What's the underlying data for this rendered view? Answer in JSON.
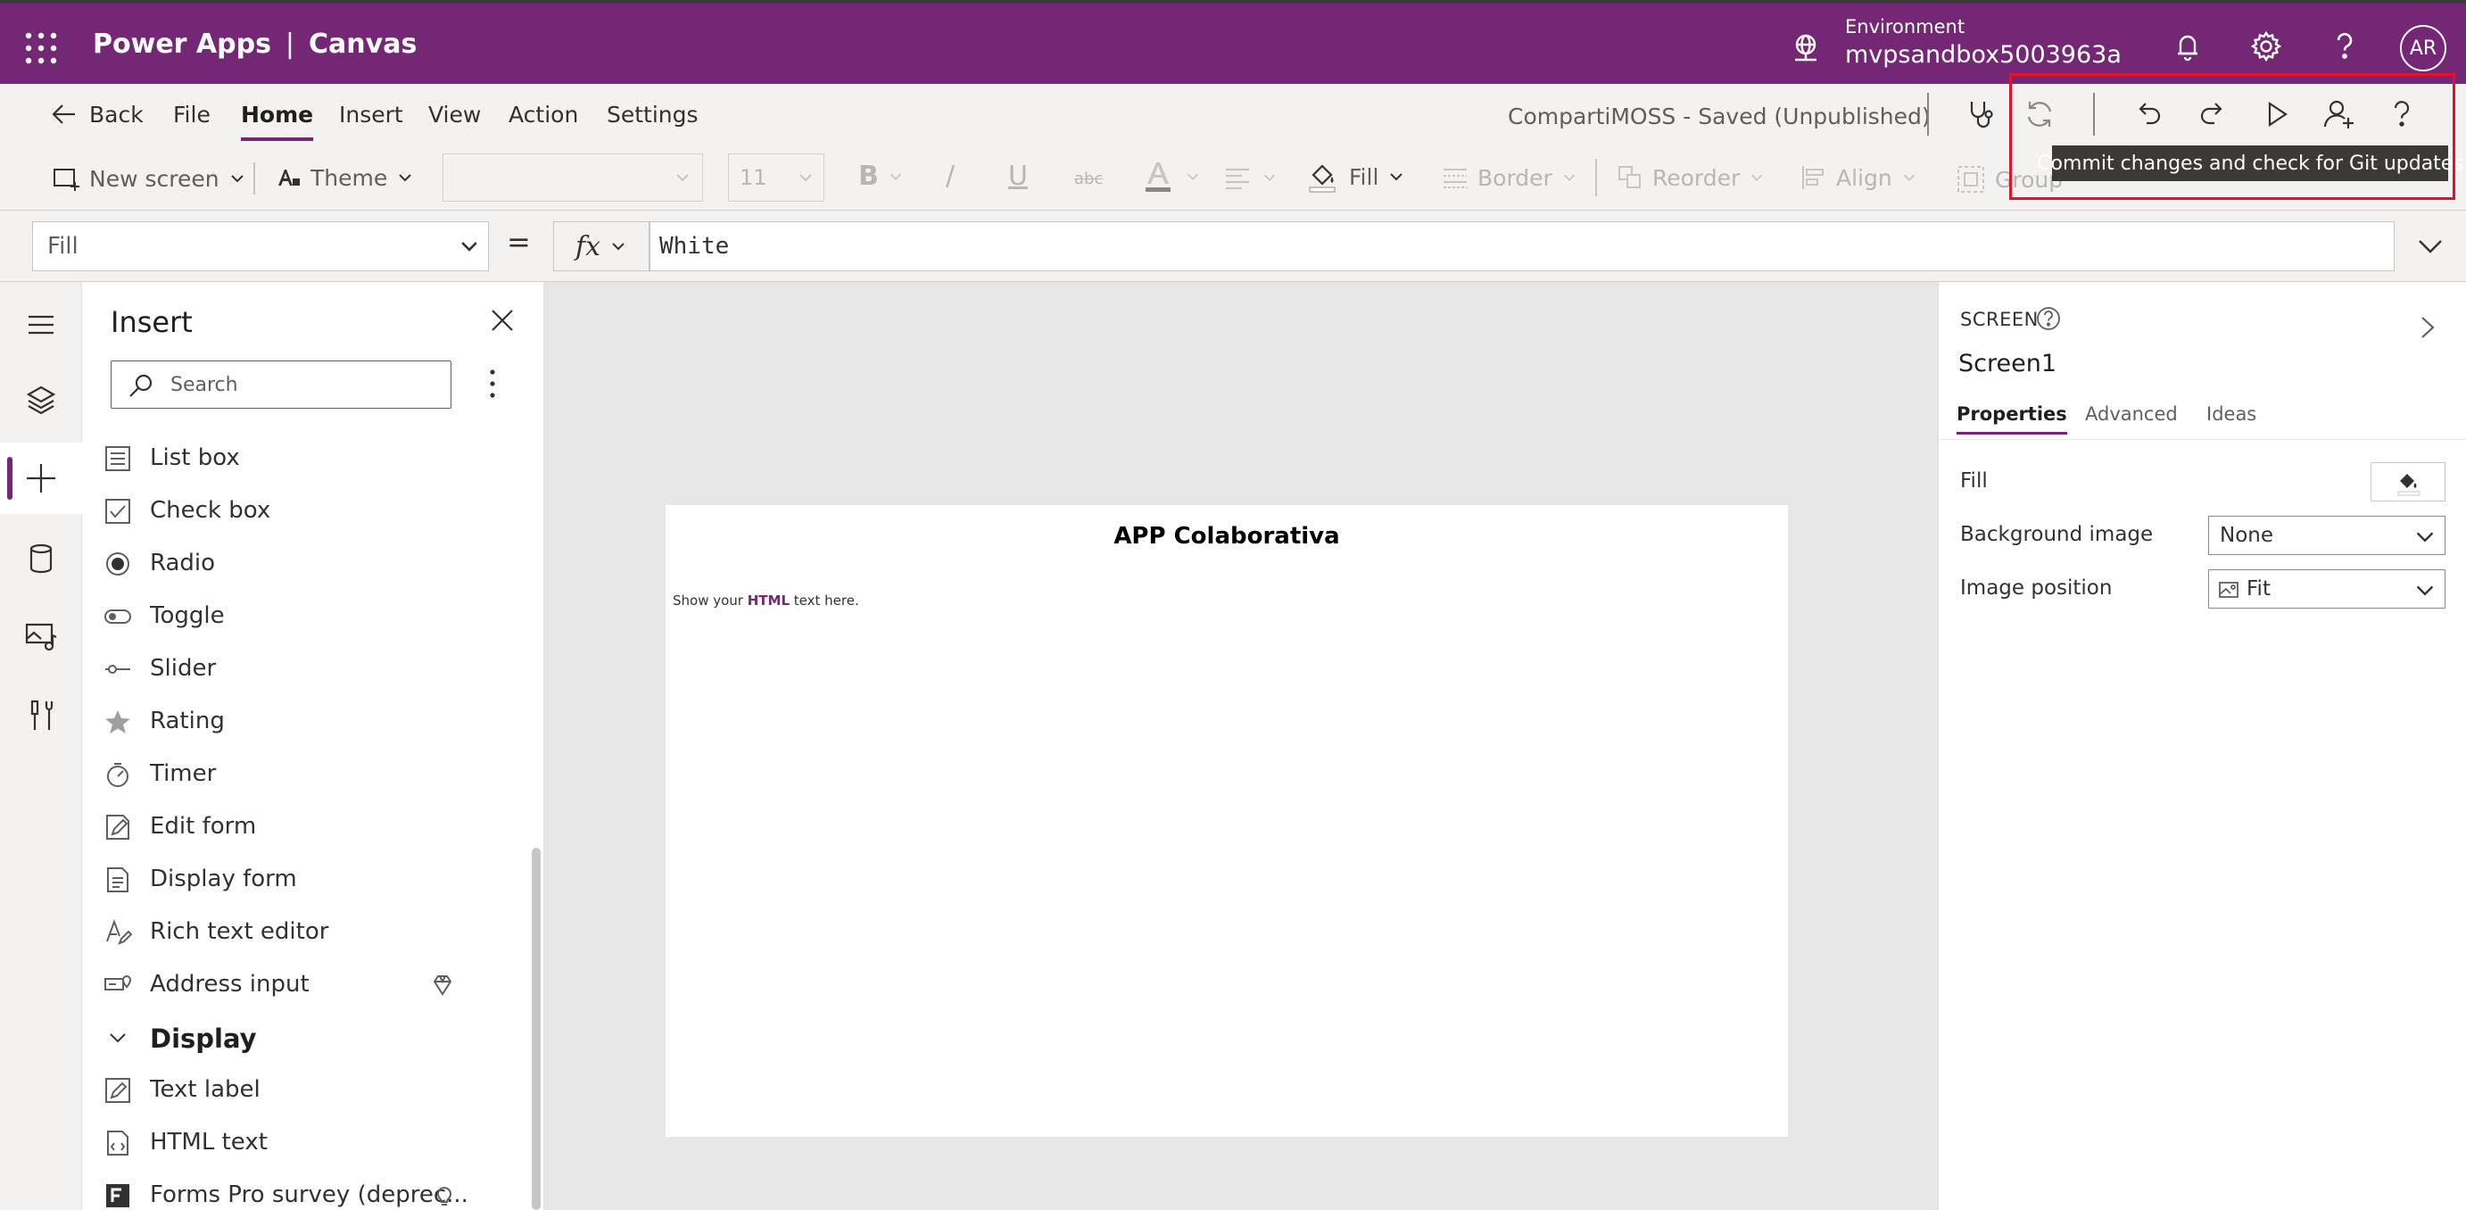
{
  "app": {
    "product": "Power Apps",
    "separator": "|",
    "mode": "Canvas",
    "environment_label": "Environment",
    "environment_value": "mvpsandbox5003963a",
    "avatar_initials": "AR",
    "brand_color": "#742774"
  },
  "menu": {
    "back": "Back",
    "items": [
      "File",
      "Home",
      "Insert",
      "View",
      "Action",
      "Settings"
    ],
    "active": "Home",
    "saved_status": "CompartiMOSS - Saved (Unpublished)"
  },
  "ribbon": {
    "new_screen": "New screen",
    "theme": "Theme",
    "font_size": "11",
    "bold": "B",
    "italic": "/",
    "underline": "U",
    "strike": "abc",
    "font_color": "A",
    "fill": "Fill",
    "border": "Border",
    "reorder": "Reorder",
    "align": "Align",
    "group": "Group"
  },
  "tooltip": "Commit changes and check for Git updates",
  "formula": {
    "property": "Fill",
    "equals": "=",
    "fx": "fx",
    "value": "White"
  },
  "insert_pane": {
    "title": "Insert",
    "search_placeholder": "Search",
    "items": [
      {
        "label": "List box",
        "icon": "list-box-icon"
      },
      {
        "label": "Check box",
        "icon": "checkbox-icon"
      },
      {
        "label": "Radio",
        "icon": "radio-icon"
      },
      {
        "label": "Toggle",
        "icon": "toggle-icon"
      },
      {
        "label": "Slider",
        "icon": "slider-icon"
      },
      {
        "label": "Rating",
        "icon": "star-icon"
      },
      {
        "label": "Timer",
        "icon": "timer-icon"
      },
      {
        "label": "Edit form",
        "icon": "edit-form-icon"
      },
      {
        "label": "Display form",
        "icon": "display-form-icon"
      },
      {
        "label": "Rich text editor",
        "icon": "rich-text-icon"
      },
      {
        "label": "Address input",
        "icon": "address-input-icon",
        "premium": true
      },
      {
        "label": "Display",
        "group": true
      },
      {
        "label": "Text label",
        "icon": "text-label-icon"
      },
      {
        "label": "HTML text",
        "icon": "html-text-icon"
      },
      {
        "label": "Forms Pro survey (deprec...",
        "icon": "forms-pro-icon",
        "tip": true
      }
    ]
  },
  "screen": {
    "title": "APP Colaborativa",
    "html_before": "Show your ",
    "html_bold": "HTML",
    "html_after": " text here."
  },
  "properties": {
    "kind": "SCREEN",
    "name": "Screen1",
    "tabs": [
      "Properties",
      "Advanced",
      "Ideas"
    ],
    "active_tab": "Properties",
    "rows": {
      "fill_label": "Fill",
      "background_label": "Background image",
      "background_value": "None",
      "position_label": "Image position",
      "position_value": "Fit"
    }
  }
}
